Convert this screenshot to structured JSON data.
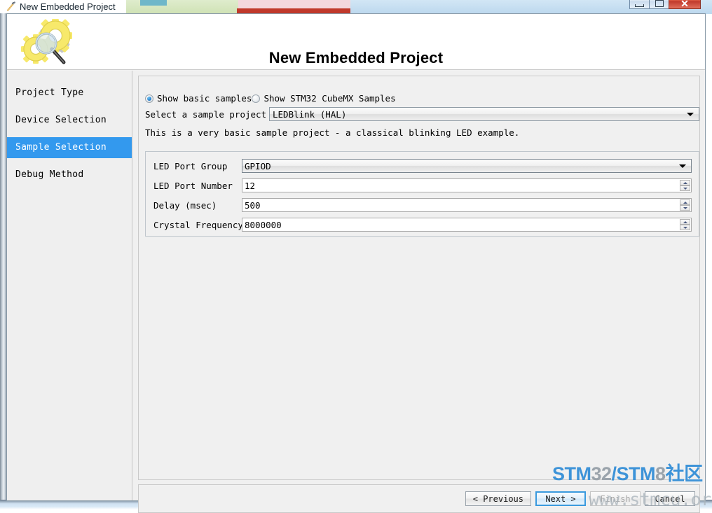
{
  "window": {
    "title": "New Embedded Project",
    "icon": "wizard-hammer-icon",
    "controls": {
      "minimize": "Minimize",
      "maximize": "Maximize",
      "close": "✕"
    }
  },
  "header": {
    "title": "New Embedded Project",
    "icon": "gears-magnifier-icon"
  },
  "sidebar": {
    "items": [
      {
        "label": "Project Type",
        "active": false
      },
      {
        "label": "Device Selection",
        "active": false
      },
      {
        "label": "Sample Selection",
        "active": true
      },
      {
        "label": "Debug Method",
        "active": false
      }
    ]
  },
  "main": {
    "sample_mode": {
      "options": [
        {
          "label": "Show basic samples",
          "checked": true
        },
        {
          "label": "Show STM32 CubeMX Samples",
          "checked": false
        }
      ]
    },
    "select_prompt": "Select a sample project to ge",
    "sample_combo": {
      "value": "LEDBlink (HAL)"
    },
    "description": "This is a very basic sample project - a classical blinking LED example.",
    "params": [
      {
        "label": "LED Port Group",
        "value": "GPIOD",
        "type": "combo"
      },
      {
        "label": "LED Port Number",
        "value": "12",
        "type": "spin"
      },
      {
        "label": "Delay (msec)",
        "value": "500",
        "type": "spin"
      },
      {
        "label": "Crystal Frequency",
        "value": "8000000",
        "type": "spin"
      }
    ]
  },
  "footer": {
    "buttons": [
      {
        "label": "< Previous",
        "state": "normal"
      },
      {
        "label": "Next >",
        "state": "focused"
      },
      {
        "label": "Finish",
        "state": "disabled"
      },
      {
        "label": "Cancel",
        "state": "normal"
      }
    ]
  },
  "watermark": {
    "part1": "STM",
    "part2": "32",
    "part3": "/STM",
    "part4": "8",
    "part5": "社区",
    "line2": "www.stmcu.org"
  },
  "colors": {
    "accent": "#3399ee",
    "focus": "#3a9ade",
    "watermark_blue": "#3d93d8",
    "watermark_gray": "#9aa3ab",
    "close_red": "#c0392b"
  }
}
